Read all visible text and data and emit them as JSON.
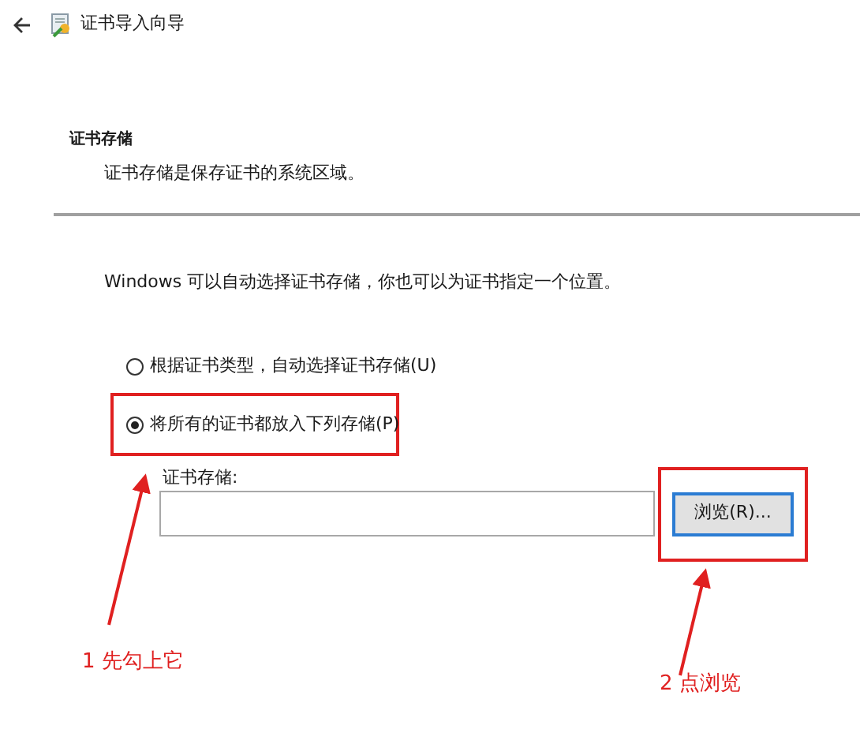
{
  "header": {
    "title": "证书导入向导"
  },
  "section": {
    "heading": "证书存储",
    "subtitle": "证书存储是保存证书的系统区域。"
  },
  "intro": "Windows 可以自动选择证书存储，你也可以为证书指定一个位置。",
  "options": [
    {
      "label": "根据证书类型，自动选择证书存储(U)",
      "selected": false,
      "highlighted": false
    },
    {
      "label": "将所有的证书都放入下列存储(P)",
      "selected": true,
      "highlighted": true
    }
  ],
  "store_field": {
    "label": "证书存储:"
  },
  "browse_button": {
    "label": "浏览(R)...",
    "highlighted": true
  },
  "annotations": [
    "1 先勾上它",
    "2 点浏览"
  ]
}
